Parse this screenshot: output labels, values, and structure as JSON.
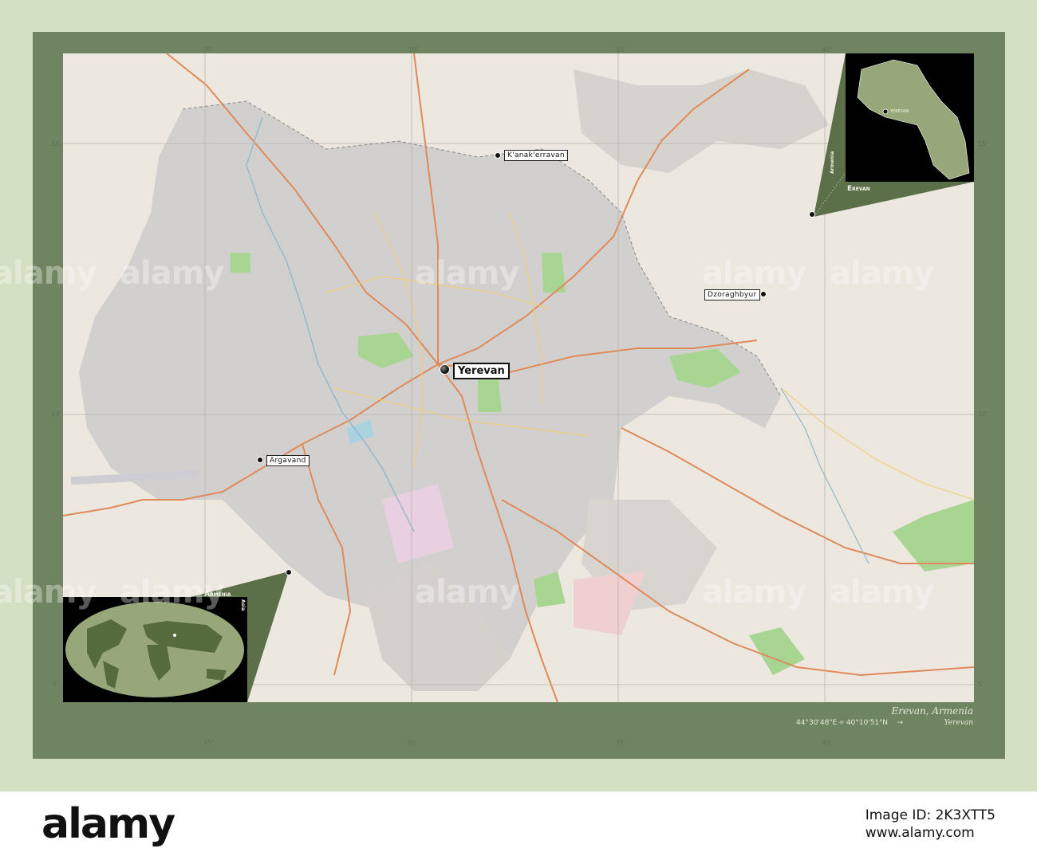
{
  "map": {
    "capital": "Yerevan",
    "places": {
      "kanakerravan": "K'anak'erravan",
      "dzoraghbyur": "Dzoraghbyur",
      "argavand": "Argavand"
    },
    "grid_top": [
      "20'",
      "30'",
      "35'",
      "40'"
    ],
    "grid_bottom": [
      "25'",
      "30'",
      "35'",
      "40'"
    ],
    "grid_left": [
      "15'",
      "10'",
      "5'"
    ],
    "grid_right": [
      "15'",
      "10'",
      "5'"
    ]
  },
  "inset_region": {
    "country": "Armenia",
    "region": "Erevan",
    "city": "Yerevan"
  },
  "inset_world": {
    "country": "Armenia",
    "continent": "Asia"
  },
  "bottom_bar": {
    "title": "Erevan, Armenia",
    "coordinates": "44°30'48\"E ⟡ 40°10'51\"N",
    "arrow": "→",
    "region": "Yerevan"
  },
  "watermark": "alamy",
  "footer": {
    "logo": "alamy",
    "image_id_label": "Image ID: 2K3XTT5",
    "url": "www.alamy.com"
  },
  "colors": {
    "frame": "#6f8460",
    "map_bg": "#ece7df",
    "urban": "#d2d0ce",
    "park": "#a9d593",
    "road": "#e08a5a",
    "inset_land": "#98a77a"
  }
}
